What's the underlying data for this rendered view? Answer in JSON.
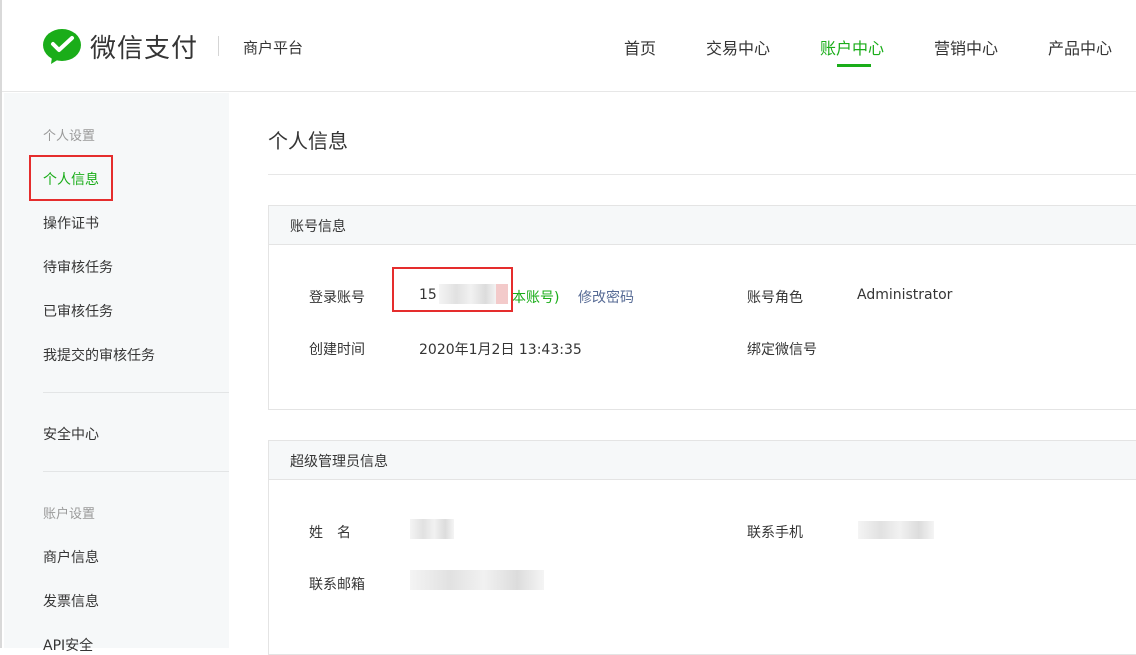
{
  "header": {
    "brand": "微信支付",
    "platform": "商户平台",
    "nav": [
      {
        "label": "首页"
      },
      {
        "label": "交易中心"
      },
      {
        "label": "账户中心"
      },
      {
        "label": "营销中心"
      },
      {
        "label": "产品中心"
      }
    ],
    "active_nav": "账户中心"
  },
  "sidebar": {
    "group1": "个人设置",
    "items1": [
      "个人信息",
      "操作证书",
      "待审核任务",
      "已审核任务",
      "我提交的审核任务"
    ],
    "security": "安全中心",
    "group2": "账户设置",
    "items2": [
      "商户信息",
      "发票信息",
      "API安全"
    ],
    "active_item": "个人信息"
  },
  "main": {
    "title": "个人信息",
    "account_panel": {
      "title": "账号信息",
      "login_label": "登录账号",
      "login_value_prefix": "15",
      "login_value_suffix": "本账号)",
      "change_password": "修改密码",
      "role_label": "账号角色",
      "role_value": "Administrator",
      "created_label": "创建时间",
      "created_value": "2020年1月2日 13:43:35",
      "wechat_label": "绑定微信号"
    },
    "admin_panel": {
      "title": "超级管理员信息",
      "name_label": "姓　名",
      "phone_label": "联系手机",
      "email_label": "联系邮箱"
    }
  },
  "colors": {
    "accent": "#1aad19",
    "link": "#576b95",
    "highlight": "#e52d2d"
  }
}
